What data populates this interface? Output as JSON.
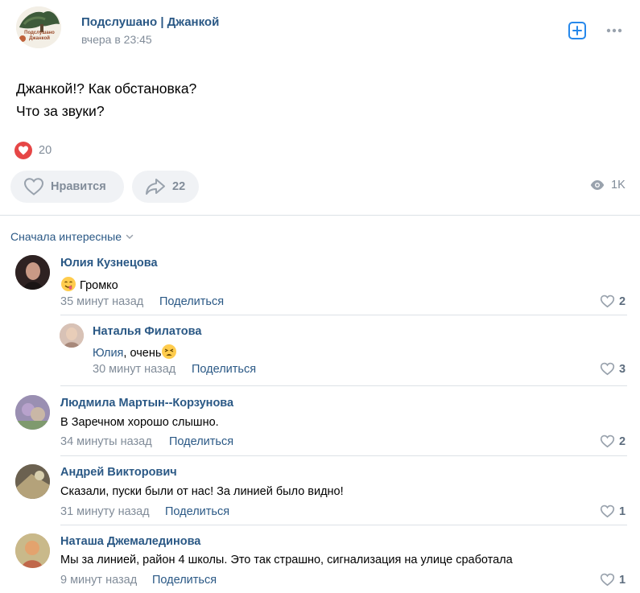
{
  "post": {
    "group_name": "Подслушано | Джанкой",
    "time": "вчера в 23:45",
    "avatar_text": "Подслушано Джанкой",
    "text_lines": [
      "Джанкой!? Как обстановка?",
      "Что за звуки?"
    ],
    "reactions_count": "20",
    "like_label": "Нравится",
    "shares_count": "22",
    "views_count": "1K"
  },
  "comments_sort": "Сначала интересные",
  "comments": [
    {
      "author": "Юлия Кузнецова",
      "text": "Громко",
      "emoji": "drooling-face-icon",
      "time": "35 минут назад",
      "share": "Поделиться",
      "likes": "2",
      "avatar_color": "#3b2a2a"
    },
    {
      "author": "Наталья Филатова",
      "mention": "Юлия",
      "text": ", очень",
      "emoji": "tired-face-icon",
      "time": "30 минут назад",
      "share": "Поделиться",
      "likes": "3",
      "avatar_color": "#c9a89a"
    },
    {
      "author": "Людмила Мартын--Корзунова",
      "text": "В Заречном хорошо слышно.",
      "time": "34 минуты назад",
      "share": "Поделиться",
      "likes": "2",
      "avatar_color": "#8e7fa8"
    },
    {
      "author": "Андрей Викторович",
      "text": "Сказали, пуски были от нас! За линией было видно!",
      "time": "31 минуту назад",
      "share": "Поделиться",
      "likes": "1",
      "avatar_color": "#7a6a4a"
    },
    {
      "author": "Наташа Джемалединова",
      "text": "Мы за линией, район 4 школы. Это так страшно, сигнализация на улице сработала",
      "time": "9 минут назад",
      "share": "Поделиться",
      "likes": "1",
      "avatar_color": "#d49a6a"
    }
  ],
  "colors": {
    "link": "#2a5885",
    "secondary": "#818c99",
    "reaction": "#e64646",
    "button_bg": "#f0f2f5",
    "divider": "#dce1e6"
  }
}
